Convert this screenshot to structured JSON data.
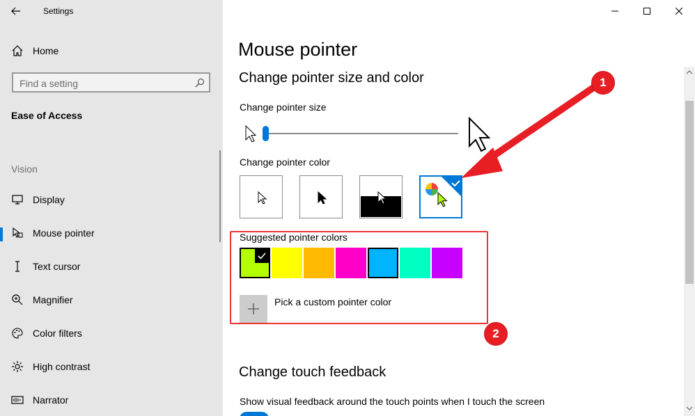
{
  "window": {
    "title": "Settings"
  },
  "sidebar": {
    "home_label": "Home",
    "search_placeholder": "Find a setting",
    "section_title": "Ease of Access",
    "group_label": "Vision",
    "items": [
      {
        "label": "Display",
        "icon": "monitor-icon"
      },
      {
        "label": "Mouse pointer",
        "icon": "mouse-pointer-icon",
        "active": true
      },
      {
        "label": "Text cursor",
        "icon": "text-cursor-icon"
      },
      {
        "label": "Magnifier",
        "icon": "magnifier-icon"
      },
      {
        "label": "Color filters",
        "icon": "color-filters-icon"
      },
      {
        "label": "High contrast",
        "icon": "high-contrast-icon"
      },
      {
        "label": "Narrator",
        "icon": "narrator-icon"
      }
    ]
  },
  "main": {
    "title": "Mouse pointer",
    "size_color_heading": "Change pointer size and color",
    "size_label": "Change pointer size",
    "size_value": 1,
    "color_label": "Change pointer color",
    "pointer_color_options": [
      "white",
      "black",
      "inverted",
      "custom"
    ],
    "selected_pointer_color": "custom",
    "suggested_label": "Suggested pointer colors",
    "suggested_colors": [
      "#b4ff00",
      "#ffff00",
      "#ffb900",
      "#ff00c8",
      "#00b4ff",
      "#00ffc3",
      "#c800ff"
    ],
    "selected_suggested_index": 0,
    "custom_label": "Pick a custom pointer color",
    "touch_heading": "Change touch feedback",
    "touch_label": "Show visual feedback around the touch points when I touch the screen",
    "touch_toggle_on": true
  },
  "annotations": {
    "badge1": "1",
    "badge2": "2",
    "color": "#e81e25"
  },
  "colors": {
    "accent": "#0078d7",
    "sidebar_bg": "#e6e6e6"
  }
}
